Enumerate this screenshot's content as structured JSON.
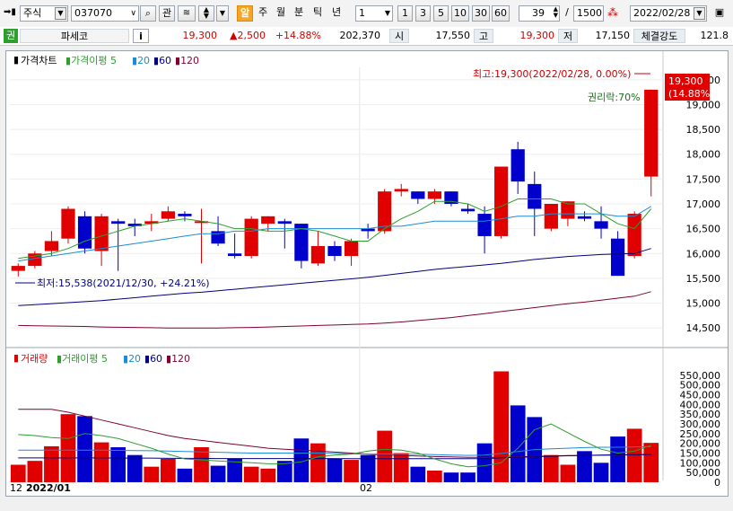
{
  "toolbar": {
    "market_select": "주식",
    "code_input": "037070",
    "interest_label": "관",
    "alert_label": "알",
    "period_tabs": [
      "주",
      "월",
      "분",
      "틱",
      "년"
    ],
    "interval_value": "1",
    "interval_presets": [
      "1",
      "3",
      "5",
      "10",
      "30",
      "60"
    ],
    "count_value": "39",
    "count_total_prefix": "/",
    "count_total": "1500",
    "date_value": "2022/02/28"
  },
  "info": {
    "market_tag": "권",
    "stock_name": "파세코",
    "info_button": "i",
    "price": "19,300",
    "change": "▲2,500",
    "change_rate": "+14.88%",
    "volume": "202,370",
    "open_label": "시",
    "open": "17,550",
    "high_label": "고",
    "high": "19,300",
    "low_label": "저",
    "low": "17,150",
    "strength_label": "체결강도",
    "strength": "121.8"
  },
  "price_legend": {
    "title": "가격차트",
    "ma_label": "가격이평",
    "periods": [
      "5",
      "20",
      "60",
      "120"
    ]
  },
  "volume_legend": {
    "title": "거래량",
    "ma_label": "거래이평",
    "periods": [
      "5",
      "20",
      "60",
      "120"
    ]
  },
  "annotations": {
    "high": "최고:19,300(2022/02/28, 0.00%)",
    "low": "최저:15,538(2021/12/30, +24.21%)",
    "rights": "권리락:70%",
    "last_price": "19,300",
    "last_rate": "(14.88%)"
  },
  "x_labels": {
    "start_day": "12",
    "year_month": "2022/01",
    "month2": "02"
  },
  "colors": {
    "up": "#e00000",
    "down": "#0000cc",
    "ma5": "#2e9e2e",
    "ma20": "#1a8cd8",
    "ma60": "#00007f",
    "ma120": "#7f0033"
  },
  "chart_data": [
    {
      "type": "candlestick",
      "title": "가격차트",
      "ylim": [
        14250,
        19750
      ],
      "y_ticks": [
        14500,
        15000,
        15500,
        16000,
        16500,
        17000,
        17500,
        18000,
        18500,
        19000,
        19500
      ],
      "candles": [
        {
          "o": 15650,
          "h": 15800,
          "l": 15538,
          "c": 15750
        },
        {
          "o": 15750,
          "h": 16050,
          "l": 15700,
          "c": 16000
        },
        {
          "o": 16050,
          "h": 16450,
          "l": 15950,
          "c": 16250
        },
        {
          "o": 16300,
          "h": 16950,
          "l": 16200,
          "c": 16900
        },
        {
          "o": 16750,
          "h": 16850,
          "l": 16000,
          "c": 16100
        },
        {
          "o": 16050,
          "h": 16800,
          "l": 15750,
          "c": 16750
        },
        {
          "o": 16650,
          "h": 16700,
          "l": 15650,
          "c": 16600
        },
        {
          "o": 16600,
          "h": 16700,
          "l": 16350,
          "c": 16550
        },
        {
          "o": 16600,
          "h": 16800,
          "l": 16450,
          "c": 16650
        },
        {
          "o": 16700,
          "h": 16950,
          "l": 16650,
          "c": 16850
        },
        {
          "o": 16800,
          "h": 16850,
          "l": 16650,
          "c": 16750
        },
        {
          "o": 16650,
          "h": 16900,
          "l": 15800,
          "c": 16650
        },
        {
          "o": 16450,
          "h": 16750,
          "l": 16150,
          "c": 16200
        },
        {
          "o": 16000,
          "h": 16400,
          "l": 15900,
          "c": 15950
        },
        {
          "o": 15950,
          "h": 16750,
          "l": 15900,
          "c": 16700
        },
        {
          "o": 16600,
          "h": 16750,
          "l": 16450,
          "c": 16750
        },
        {
          "o": 16650,
          "h": 16700,
          "l": 16100,
          "c": 16600
        },
        {
          "o": 16600,
          "h": 16600,
          "l": 15700,
          "c": 15850
        },
        {
          "o": 15800,
          "h": 16450,
          "l": 15750,
          "c": 16150
        },
        {
          "o": 16150,
          "h": 16250,
          "l": 15850,
          "c": 15950
        },
        {
          "o": 15950,
          "h": 16300,
          "l": 15750,
          "c": 16250
        },
        {
          "o": 16500,
          "h": 16600,
          "l": 16300,
          "c": 16450
        },
        {
          "o": 16450,
          "h": 17300,
          "l": 16400,
          "c": 17250
        },
        {
          "o": 17250,
          "h": 17400,
          "l": 17150,
          "c": 17300
        },
        {
          "o": 17250,
          "h": 17250,
          "l": 17000,
          "c": 17100
        },
        {
          "o": 17100,
          "h": 17300,
          "l": 17000,
          "c": 17250
        },
        {
          "o": 17250,
          "h": 17250,
          "l": 16950,
          "c": 17000
        },
        {
          "o": 16900,
          "h": 17000,
          "l": 16800,
          "c": 16850
        },
        {
          "o": 16800,
          "h": 16950,
          "l": 16000,
          "c": 16350
        },
        {
          "o": 16350,
          "h": 17750,
          "l": 16300,
          "c": 17750
        },
        {
          "o": 18100,
          "h": 18250,
          "l": 17200,
          "c": 17450
        },
        {
          "o": 17400,
          "h": 17650,
          "l": 16350,
          "c": 16900
        },
        {
          "o": 16500,
          "h": 17000,
          "l": 16450,
          "c": 17000
        },
        {
          "o": 16700,
          "h": 17050,
          "l": 16550,
          "c": 17050
        },
        {
          "o": 16750,
          "h": 16850,
          "l": 16650,
          "c": 16700
        },
        {
          "o": 16650,
          "h": 16950,
          "l": 16300,
          "c": 16500
        },
        {
          "o": 16300,
          "h": 16450,
          "l": 15550,
          "c": 15550
        },
        {
          "o": 15950,
          "h": 16850,
          "l": 15900,
          "c": 16800
        },
        {
          "o": 17550,
          "h": 19300,
          "l": 17150,
          "c": 19300
        }
      ],
      "ma5": [
        15900,
        15950,
        16000,
        16100,
        16250,
        16350,
        16450,
        16550,
        16600,
        16650,
        16700,
        16650,
        16600,
        16500,
        16500,
        16450,
        16450,
        16500,
        16450,
        16350,
        16250,
        16250,
        16500,
        16700,
        16850,
        17050,
        17050,
        17000,
        16850,
        16950,
        17100,
        17100,
        17100,
        17000,
        17000,
        16800,
        16600,
        16500,
        16900
      ],
      "ma20": [
        15850,
        15900,
        15950,
        16000,
        16050,
        16100,
        16150,
        16200,
        16250,
        16300,
        16350,
        16400,
        16400,
        16450,
        16450,
        16500,
        16500,
        16500,
        16500,
        16500,
        16500,
        16500,
        16550,
        16550,
        16600,
        16650,
        16650,
        16650,
        16650,
        16700,
        16750,
        16750,
        16800,
        16800,
        16800,
        16800,
        16750,
        16750,
        16950
      ],
      "ma60": [
        14950,
        14970,
        14990,
        15010,
        15030,
        15050,
        15080,
        15110,
        15140,
        15170,
        15200,
        15220,
        15250,
        15280,
        15310,
        15340,
        15370,
        15400,
        15430,
        15460,
        15490,
        15520,
        15560,
        15600,
        15640,
        15680,
        15710,
        15740,
        15770,
        15800,
        15840,
        15880,
        15910,
        15940,
        15960,
        15980,
        15990,
        16000,
        16100
      ],
      "ma120": [
        14550,
        14545,
        14540,
        14535,
        14530,
        14520,
        14515,
        14510,
        14505,
        14500,
        14500,
        14500,
        14500,
        14505,
        14510,
        14520,
        14530,
        14540,
        14550,
        14560,
        14570,
        14580,
        14600,
        14620,
        14650,
        14680,
        14710,
        14750,
        14790,
        14830,
        14870,
        14910,
        14950,
        14990,
        15020,
        15060,
        15100,
        15140,
        15230
      ]
    },
    {
      "type": "bar",
      "title": "거래량",
      "ylim": [
        0,
        600000
      ],
      "y_ticks": [
        0,
        50000,
        100000,
        150000,
        200000,
        250000,
        300000,
        350000,
        400000,
        450000,
        500000,
        550000
      ],
      "values": [
        90000,
        110000,
        185000,
        350000,
        340000,
        205000,
        180000,
        140000,
        80000,
        120000,
        70000,
        180000,
        85000,
        120000,
        80000,
        70000,
        110000,
        225000,
        200000,
        120000,
        115000,
        140000,
        265000,
        150000,
        80000,
        60000,
        50000,
        50000,
        200000,
        570000,
        395000,
        335000,
        140000,
        90000,
        160000,
        100000,
        235000,
        275000,
        202370
      ],
      "ma5": [
        245000,
        240000,
        230000,
        225000,
        250000,
        240000,
        225000,
        200000,
        175000,
        145000,
        120000,
        115000,
        110000,
        105000,
        100000,
        95000,
        95000,
        105000,
        130000,
        140000,
        145000,
        160000,
        170000,
        165000,
        150000,
        120000,
        95000,
        80000,
        85000,
        100000,
        175000,
        270000,
        300000,
        255000,
        210000,
        170000,
        150000,
        160000,
        190000
      ],
      "ma20": [
        165000,
        165000,
        165000,
        165000,
        165000,
        165000,
        164000,
        163000,
        162000,
        160000,
        158000,
        156000,
        154000,
        152000,
        150000,
        150000,
        150000,
        150000,
        150000,
        148000,
        146000,
        145000,
        145000,
        145000,
        144000,
        142000,
        140000,
        138000,
        140000,
        148000,
        158000,
        168000,
        172000,
        175000,
        178000,
        180000,
        180000,
        182000,
        183000
      ],
      "ma60": [
        125000,
        125000,
        125000,
        125000,
        125000,
        125000,
        124000,
        124000,
        124000,
        123000,
        123000,
        123000,
        122000,
        122000,
        122000,
        122000,
        122000,
        122000,
        122000,
        122000,
        121000,
        121000,
        121000,
        121000,
        121000,
        121000,
        121000,
        121000,
        122000,
        125000,
        128000,
        131000,
        134000,
        136000,
        138000,
        140000,
        141000,
        142000,
        143000
      ],
      "ma120": [
        375000,
        375000,
        375000,
        360000,
        340000,
        320000,
        300000,
        280000,
        260000,
        240000,
        225000,
        215000,
        205000,
        195000,
        185000,
        175000,
        170000,
        165000,
        160000,
        155000,
        150000,
        145000,
        140000,
        138000,
        135000,
        132000,
        130000,
        128000,
        128000,
        128000,
        130000,
        133000,
        135000,
        137000,
        138000,
        139000,
        140000,
        141000,
        142000
      ]
    }
  ]
}
